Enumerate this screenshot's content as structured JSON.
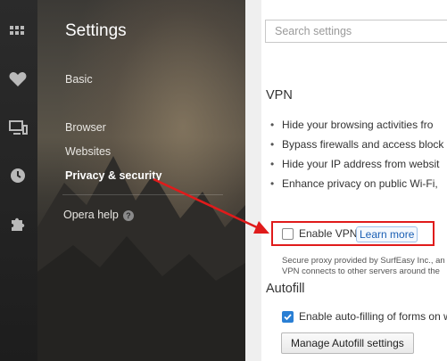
{
  "rail": {
    "icons": [
      "apps-icon",
      "heart-icon",
      "devices-icon",
      "history-icon",
      "extensions-icon"
    ]
  },
  "sidebar": {
    "title": "Settings",
    "items": [
      {
        "label": "Basic"
      },
      {
        "label": "Browser"
      },
      {
        "label": "Websites"
      },
      {
        "label": "Privacy & security",
        "active": true
      }
    ],
    "help_label": "Opera help",
    "help_icon": "?"
  },
  "main": {
    "search": {
      "placeholder": "Search settings"
    },
    "vpn": {
      "title": "VPN",
      "bullets": [
        "Hide your browsing activities fro",
        "Bypass firewalls and access block",
        "Hide your IP address from websit",
        "Enhance privacy on public Wi-Fi,"
      ],
      "enable_label": "Enable VPN",
      "enable_checked": false,
      "learn_more": "Learn more",
      "note_line1": "Secure proxy provided by SurfEasy Inc., an",
      "note_line2": "VPN connects to other servers around the"
    },
    "autofill": {
      "title": "Autofill",
      "enable_label": "Enable auto-filling of forms on w",
      "enable_checked": true,
      "manage_button": "Manage Autofill settings"
    }
  },
  "colors": {
    "highlight_border": "#e01b1b",
    "checkbox_accent": "#2a7fd4",
    "link": "#1a5fb4"
  }
}
